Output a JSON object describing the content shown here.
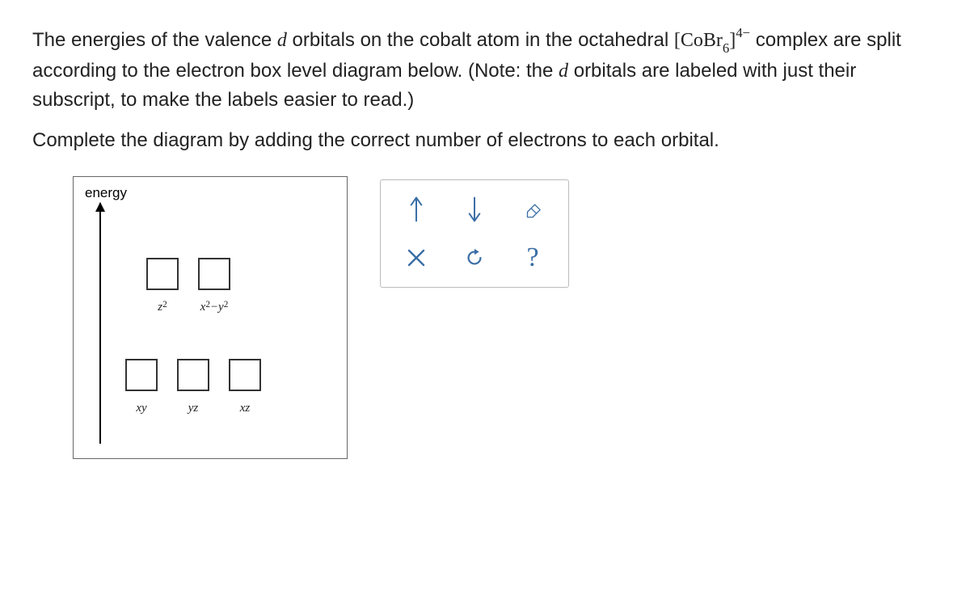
{
  "question": {
    "line1_pre": "The energies of the valence ",
    "line1_orb": "d",
    "line1_mid": " orbitals on the cobalt atom in the octahedral ",
    "formula_open": "[",
    "formula_core": "CoBr",
    "formula_sub": "6",
    "formula_close": "]",
    "formula_sup": "4−",
    "line1_post": " complex are split according to the electron box level diagram below. (Note: the ",
    "line1_orb2": "d",
    "line1_end": " orbitals are labeled with just their subscript, to make the labels easier to read.)",
    "line2": "Complete the diagram by adding the correct number of electrons to each orbital."
  },
  "diagram": {
    "energy_label": "energy",
    "upper": [
      {
        "base": "z",
        "sup": "2"
      },
      {
        "pre": "x",
        "presup": "2",
        "mid": "−y",
        "postsup": "2"
      }
    ],
    "lower": [
      {
        "base": "xy"
      },
      {
        "base": "yz"
      },
      {
        "base": "xz"
      }
    ]
  },
  "tools": {
    "up_arrow": "up-arrow",
    "down_arrow": "down-arrow",
    "eraser": "eraser",
    "clear": "clear",
    "reset": "reset",
    "help": "?"
  }
}
